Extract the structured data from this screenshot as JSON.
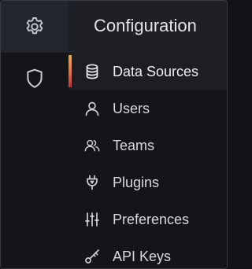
{
  "rail": {
    "items": [
      {
        "icon": "gear-icon",
        "active": true
      },
      {
        "icon": "shield-icon",
        "active": false
      }
    ]
  },
  "panel": {
    "title": "Configuration",
    "items": [
      {
        "label": "Data Sources",
        "icon": "database-icon",
        "active": true
      },
      {
        "label": "Users",
        "icon": "user-icon",
        "active": false
      },
      {
        "label": "Teams",
        "icon": "users-icon",
        "active": false
      },
      {
        "label": "Plugins",
        "icon": "plug-icon",
        "active": false
      },
      {
        "label": "Preferences",
        "icon": "sliders-icon",
        "active": false
      },
      {
        "label": "API Keys",
        "icon": "key-icon",
        "active": false
      }
    ]
  },
  "colors": {
    "background": "#111217",
    "rail_active": "#22252b",
    "header": "#1e2026",
    "text": "#d8d9da",
    "accent_top": "#f2a94a",
    "accent_bottom": "#c4313a"
  }
}
